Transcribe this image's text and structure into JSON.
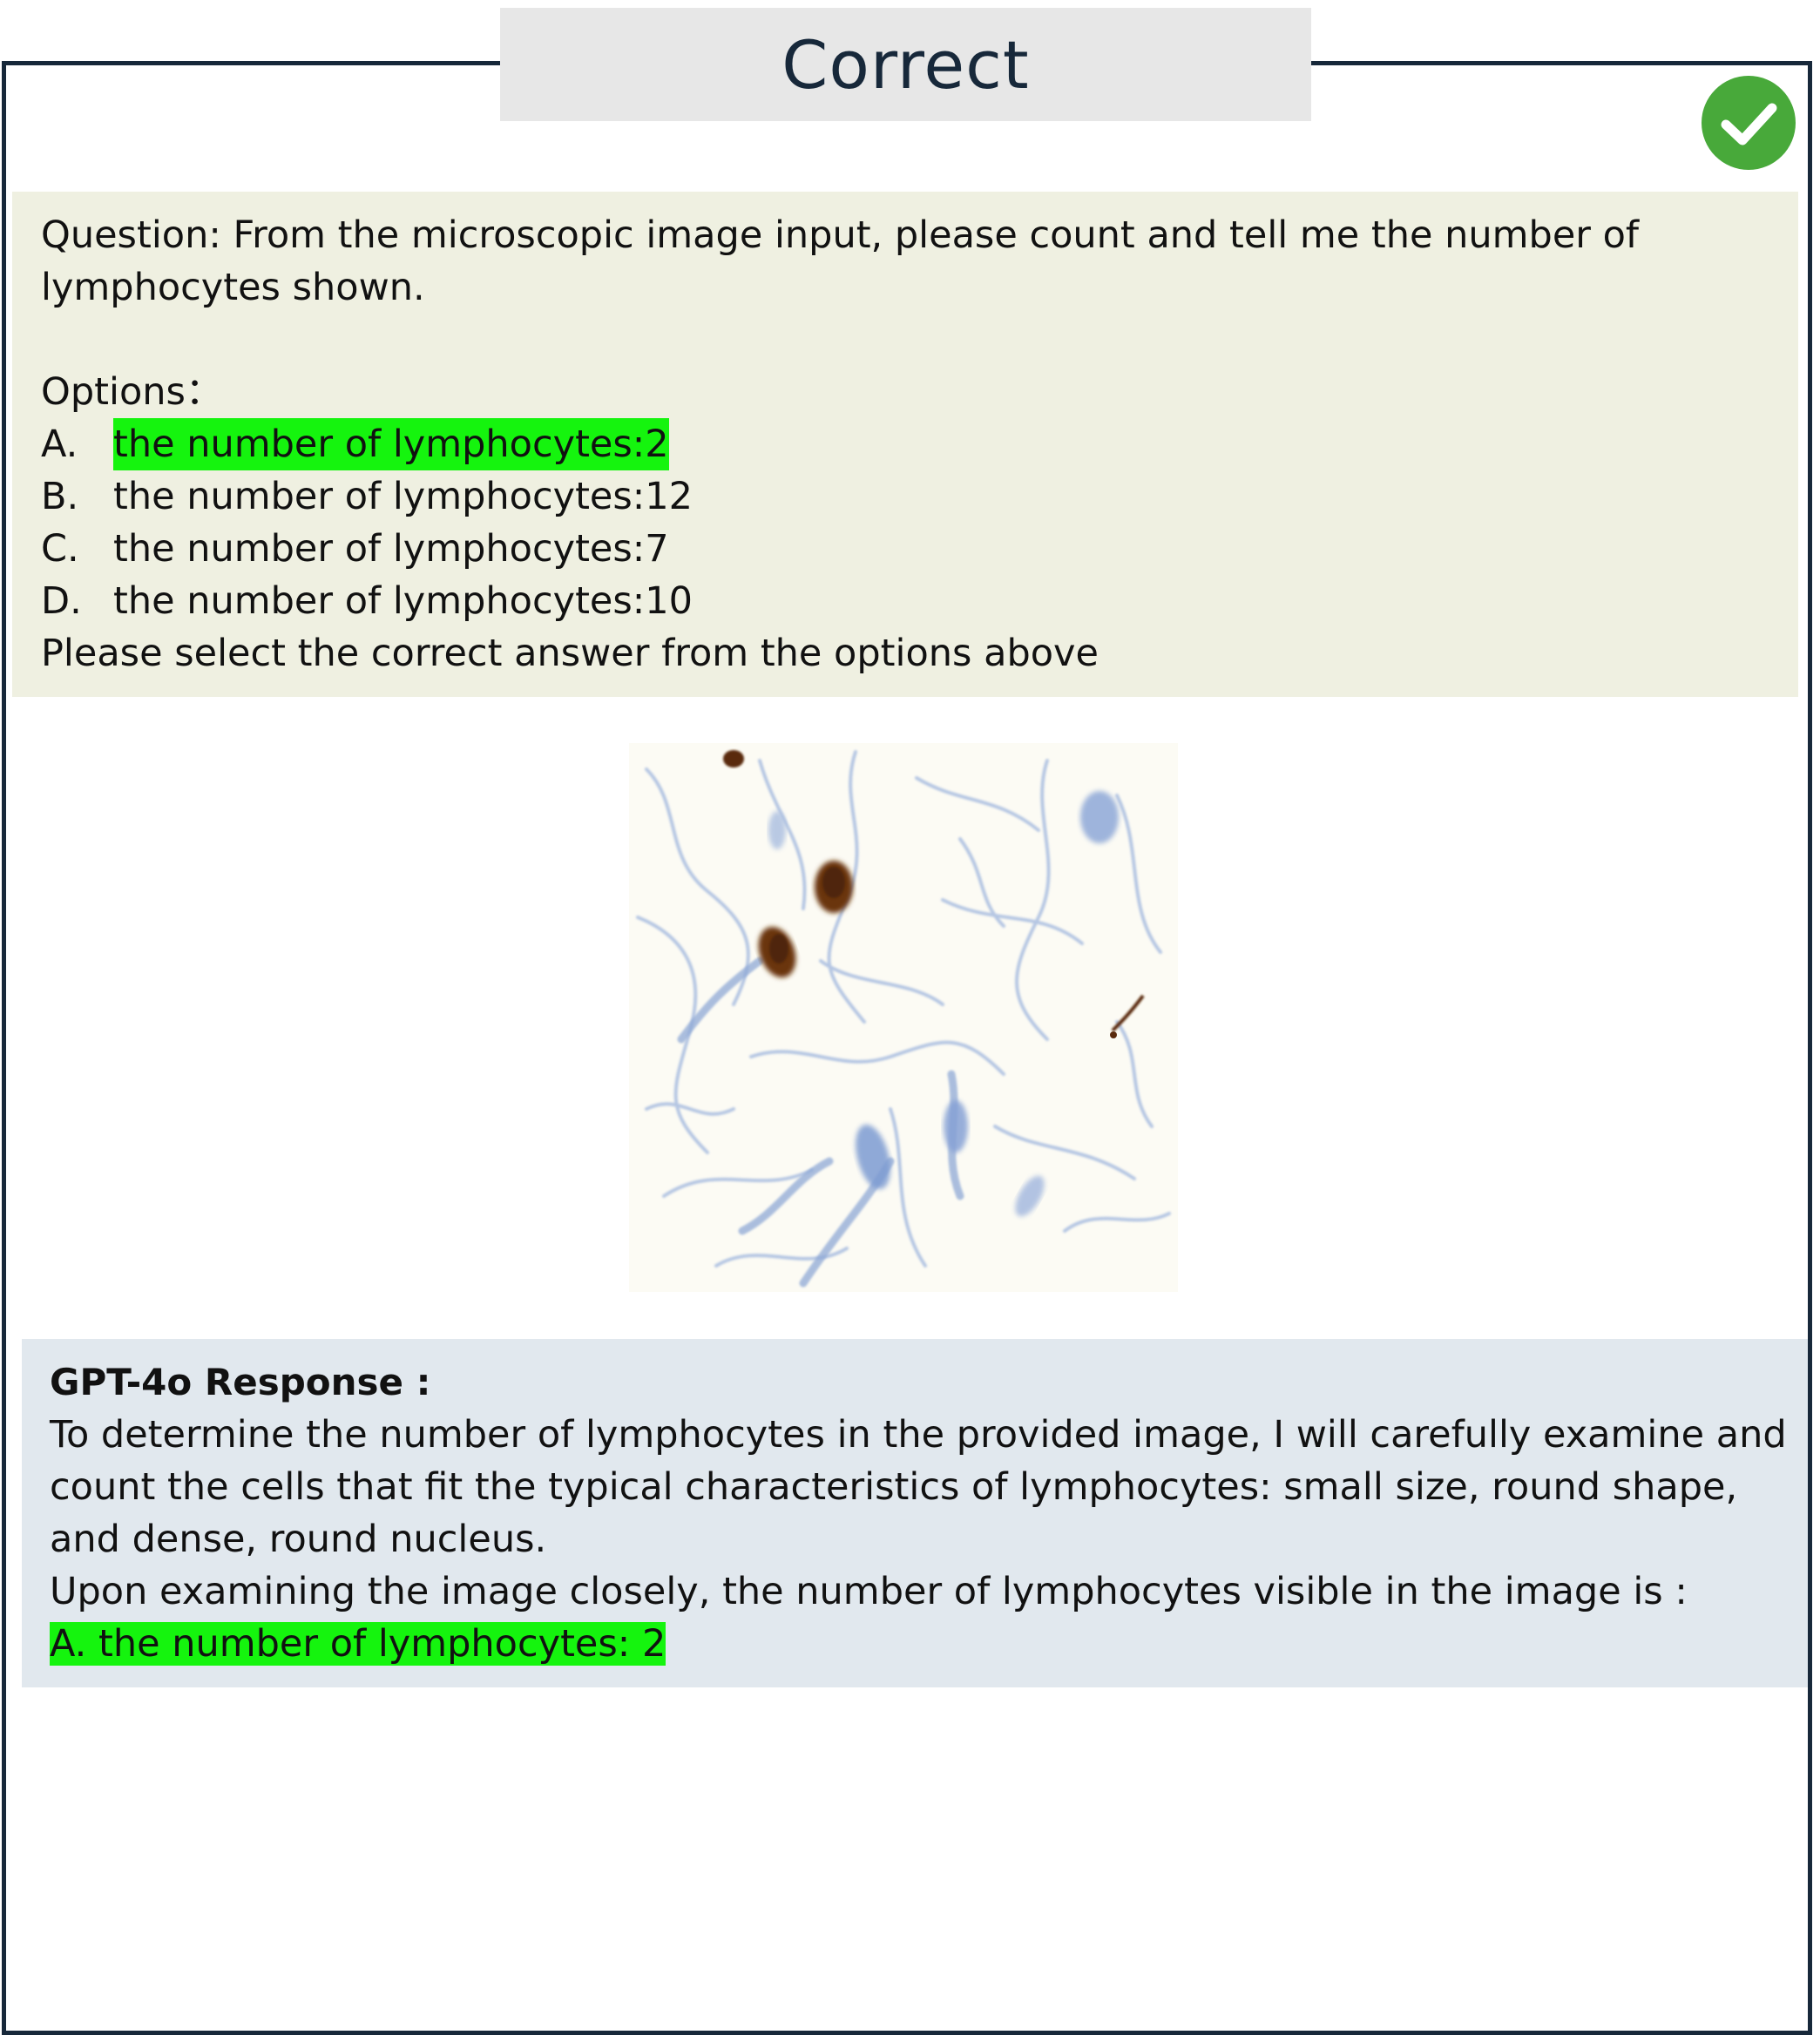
{
  "header": {
    "title": "Correct",
    "status_icon": "check-icon",
    "status_color": "#48a93a"
  },
  "question": {
    "lines": [
      "Question: From the microscopic image input, please count and tell me the number of",
      "lymphocytes shown."
    ],
    "options_label": "Options：",
    "options": [
      {
        "letter": "A.",
        "text": "the number of lymphocytes:2",
        "highlighted": true
      },
      {
        "letter": "B.",
        "text": "the number of lymphocytes:12",
        "highlighted": false
      },
      {
        "letter": "C.",
        "text": "the number of lymphocytes:7",
        "highlighted": false
      },
      {
        "letter": "D.",
        "text": "the number of lymphocytes:10",
        "highlighted": false
      }
    ],
    "instruction": "Please select the correct answer from the options above"
  },
  "response": {
    "heading": "GPT-4o Response :",
    "lines": [
      "To determine the number of lymphocytes in the provided image, I will carefully examine and",
      "count the cells that fit the typical characteristics of lymphocytes: small size, round shape,",
      "and dense, round nucleus.",
      "Upon examining the image closely, the number of lymphocytes visible in the image is :"
    ],
    "answer": "A. the number of lymphocytes: 2"
  },
  "colors": {
    "frame": "#17283a",
    "highlight": "#15f40e",
    "question_bg": "#eff0e1",
    "response_bg": "#e1e8ee"
  }
}
